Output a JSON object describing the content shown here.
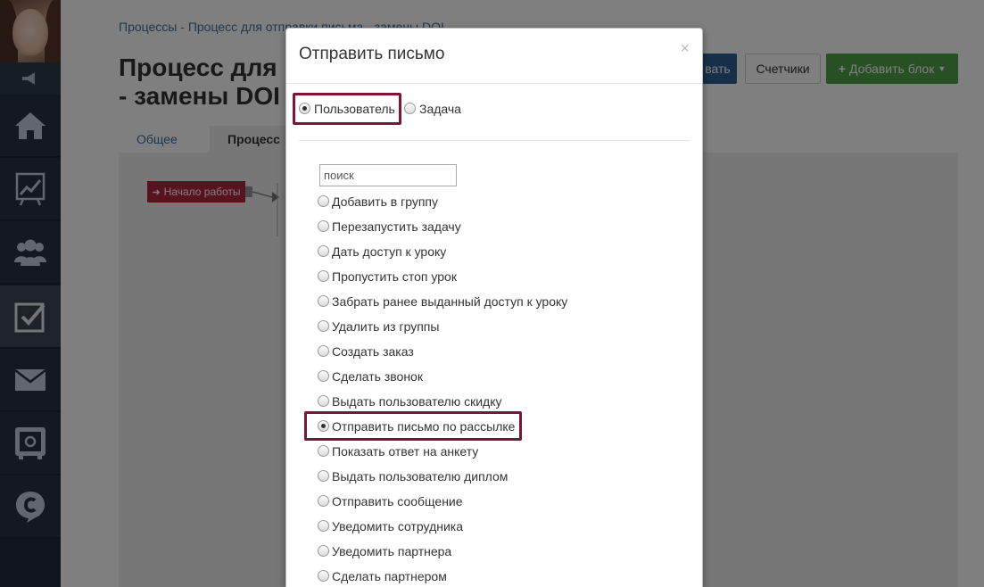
{
  "breadcrumb": {
    "item1": "Процессы",
    "sep": "-",
    "item2": "Процесс для отправки письма - замены DOI"
  },
  "page": {
    "title_line1": "Процесс для",
    "title_line2": "- замены DOI"
  },
  "toolbar": {
    "save_label": "вать",
    "counters_label": "Счетчики",
    "add_block_label": "Добавить блок"
  },
  "tabs": [
    {
      "label": "Общее"
    },
    {
      "label": "Процесс"
    }
  ],
  "canvas": {
    "start_node_label": "Начало работы"
  },
  "modal": {
    "title": "Отправить письмо",
    "close_symbol": "×",
    "target_options": [
      {
        "label": "Пользователь",
        "checked": true
      },
      {
        "label": "Задача",
        "checked": false
      }
    ],
    "search_placeholder": "поиск",
    "actions": [
      {
        "label": "Добавить в группу",
        "checked": false
      },
      {
        "label": "Перезапустить задачу",
        "checked": false
      },
      {
        "label": "Дать доступ к уроку",
        "checked": false
      },
      {
        "label": "Пропустить стоп урок",
        "checked": false
      },
      {
        "label": "Забрать ранее выданный доступ к уроку",
        "checked": false
      },
      {
        "label": "Удалить из группы",
        "checked": false
      },
      {
        "label": "Создать заказ",
        "checked": false
      },
      {
        "label": "Сделать звонок",
        "checked": false
      },
      {
        "label": "Выдать пользователю скидку",
        "checked": false
      },
      {
        "label": "Отправить письмо по рассылке",
        "checked": true
      },
      {
        "label": "Показать ответ на анкету",
        "checked": false
      },
      {
        "label": "Выдать пользователю диплом",
        "checked": false
      },
      {
        "label": "Отправить сообщение",
        "checked": false
      },
      {
        "label": "Уведомить сотрудника",
        "checked": false
      },
      {
        "label": "Уведомить партнера",
        "checked": false
      },
      {
        "label": "Сделать партнером",
        "checked": false
      }
    ]
  },
  "colors": {
    "highlight": "#7d1635",
    "sidebar": "#1e2a36",
    "primary_button": "#2f5f93",
    "add_button": "#4ea24a",
    "start_node": "#b3263c"
  },
  "icons": [
    "megaphone-icon",
    "home-icon",
    "chart-icon",
    "users-icon",
    "checkbox-icon",
    "mail-icon",
    "safe-icon",
    "chat-icon",
    "sign-in-icon",
    "plus-icon",
    "caret-down-icon"
  ]
}
